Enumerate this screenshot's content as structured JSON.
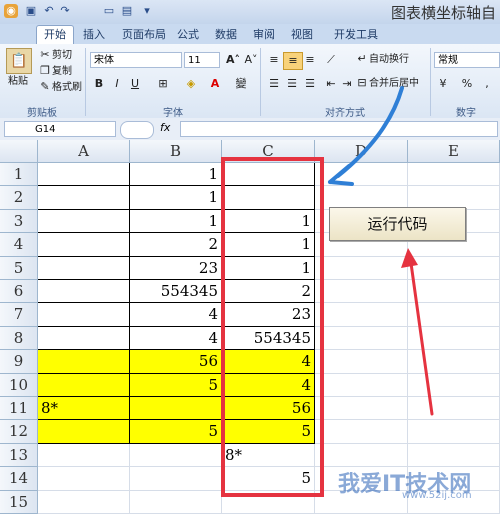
{
  "window": {
    "title": "图表横坐标轴自"
  },
  "tabs": [
    "开始",
    "插入",
    "页面布局",
    "公式",
    "数据",
    "审阅",
    "视图",
    "开发工具"
  ],
  "ribbon": {
    "clipboard": {
      "paste": "粘贴",
      "cut": "剪切",
      "copy": "复制",
      "format_painter": "格式刷",
      "label": "剪贴板"
    },
    "font": {
      "name": "宋体",
      "size": "11",
      "label": "字体",
      "bold": "B",
      "italic": "I",
      "underline": "U"
    },
    "alignment": {
      "wrap": "自动换行",
      "merge": "合并后居中",
      "label": "对齐方式"
    },
    "number": {
      "format": "常规",
      "label": "数字",
      "percent": "%",
      "comma": ","
    }
  },
  "formula_bar": {
    "name_box": "G14",
    "fx": "fx",
    "value": ""
  },
  "columns": [
    "A",
    "B",
    "C",
    "D",
    "E"
  ],
  "rows": [
    "1",
    "2",
    "3",
    "4",
    "5",
    "6",
    "7",
    "8",
    "9",
    "10",
    "11",
    "12",
    "13",
    "14",
    "15"
  ],
  "cells": {
    "B1": "1",
    "B2": "1",
    "B3": "1",
    "B4": "2",
    "B5": "23",
    "B6": "554345",
    "B7": "4",
    "B8": "4",
    "B9": "56",
    "B10": "5",
    "A11": "8*",
    "B12": "5",
    "C3": "1",
    "C4": "1",
    "C5": "1",
    "C6": "2",
    "C7": "23",
    "C8": "554345",
    "C9": "4",
    "C10": "4",
    "C11": "56",
    "C12": "5",
    "C13": "8*",
    "C14": "5"
  },
  "run_button": {
    "label": "运行代码"
  },
  "watermark": {
    "text": "我爱IT技术网",
    "url": "www.52ij.com"
  },
  "colors": {
    "highlight": "#ffff00",
    "annotation": "#e53340",
    "arrow_blue": "#2f7fd6"
  }
}
